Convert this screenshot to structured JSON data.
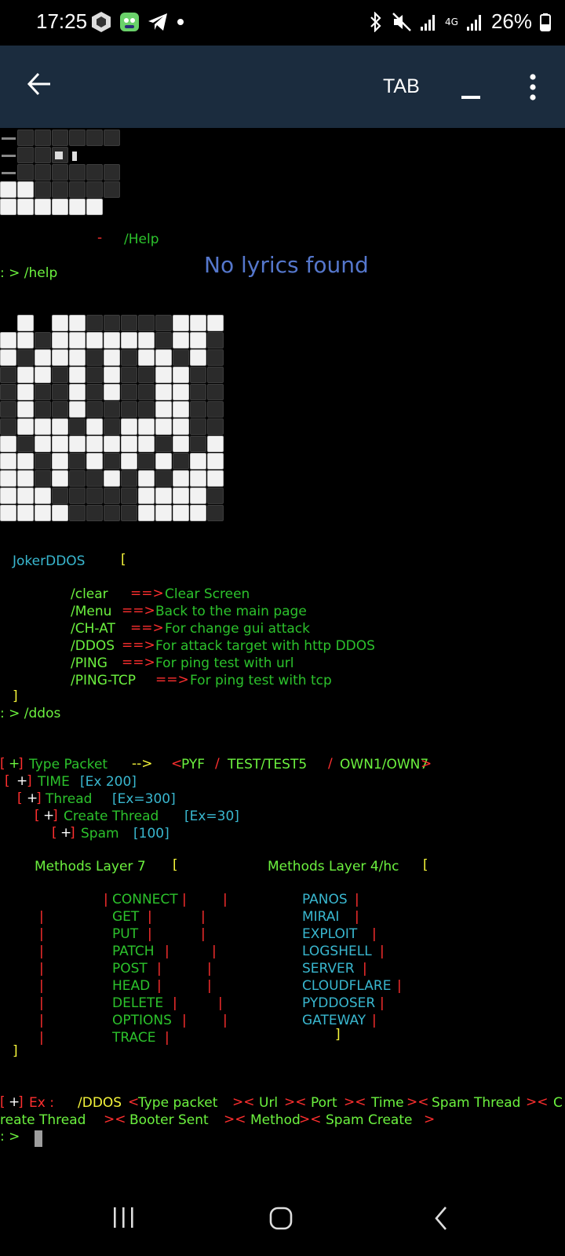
{
  "status": {
    "time": "17:25",
    "battery": "26%",
    "network": "4G"
  },
  "appbar": {
    "tab_label": "TAB"
  },
  "terminal": {
    "help_hint_dash": "-",
    "help_hint": "/Help",
    "lyrics": "No lyrics found",
    "prompt1": ": > /help",
    "tool_name": "JokerDDOS",
    "bracket_open": "[",
    "bracket_close": "]",
    "arrow": "==>",
    "commands": [
      {
        "cmd": "/clear",
        "desc": "Clear Screen"
      },
      {
        "cmd": "/Menu",
        "desc": "Back to the main page"
      },
      {
        "cmd": "/CH-AT",
        "desc": "For change gui attack"
      },
      {
        "cmd": "/DDOS",
        "desc": "For attack target with http DDOS"
      },
      {
        "cmd": "/PING",
        "desc": "For ping test with url"
      },
      {
        "cmd": "/PING-TCP",
        "desc": "For ping test with tcp"
      }
    ],
    "prompt2": ": > /ddos",
    "plus_tag": "+",
    "type_packet": {
      "label": "Type Packet",
      "arrow": "-->",
      "lt": "<",
      "opt1": "PYF",
      "slash": "/",
      "opt2": "TEST/TEST5",
      "opt3": "OWN1/OWN7",
      "gt": ">"
    },
    "time_line": {
      "label": "TIME",
      "value": "[Ex 200]"
    },
    "thread_line": {
      "label": "Thread",
      "value": "[Ex=300]"
    },
    "create_thread_line": {
      "label": "Create Thread",
      "value": "[Ex=30]"
    },
    "spam_line": {
      "label": "Spam",
      "value": "[100]"
    },
    "methods_l7_title": "Methods Layer 7",
    "methods_l4_title": "Methods Layer 4/hc",
    "pipe": "|",
    "methods_l7": [
      "CONNECT",
      "GET",
      "PUT",
      "PATCH",
      "POST",
      "HEAD",
      "DELETE",
      "OPTIONS",
      "TRACE"
    ],
    "methods_l4": [
      "PANOS",
      "MIRAI",
      "EXPLOIT",
      "LOGSHELL",
      "SERVER",
      "CLOUDFLARE",
      "PYDDOSER",
      "GATEWAY"
    ],
    "example": {
      "label": "Ex :",
      "cmd": "/DDOS",
      "sep": "><",
      "lt": "<",
      "gt": ">",
      "arg1": "Type packet",
      "arg2": "Url",
      "arg3": "Port",
      "arg4": "Time",
      "arg5": "Spam Thread",
      "arg6a": "C",
      "arg6b": "reate Thread",
      "arg7": "Booter Sent",
      "arg8": "Method",
      "arg9": "Spam Create"
    },
    "prompt3": ": >"
  }
}
